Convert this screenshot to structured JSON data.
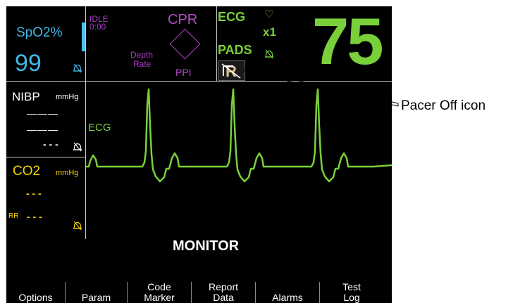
{
  "spo2": {
    "label": "SpO2%",
    "value": "99"
  },
  "cpr": {
    "status": "IDLE",
    "time": "0:00",
    "title": "CPR",
    "depth_label": "Depth",
    "rate_label": "Rate",
    "ppi_label": "PPI"
  },
  "ecg_source": {
    "label": "ECG",
    "gain": "x1",
    "pads_label": "PADS",
    "heart_symbol": "♡",
    "heart_rate": "75"
  },
  "nibp": {
    "label": "NIBP",
    "unit": "mmHg",
    "systolic": "———",
    "diastolic": "———",
    "mean": "- - -"
  },
  "co2": {
    "label": "CO2",
    "unit": "mmHg",
    "value": "- - -",
    "rr_label": "RR",
    "rr_value": "- - -"
  },
  "waveform": {
    "label": "ECG"
  },
  "mode": "MONITOR",
  "softkeys": [
    {
      "label": "Options"
    },
    {
      "label": "Param"
    },
    {
      "label": "Code\nMarker"
    },
    {
      "label": "Report\nData"
    },
    {
      "label": "Alarms"
    },
    {
      "label": "Test\nLog"
    }
  ],
  "callout": {
    "text": "Pacer Off icon"
  },
  "colors": {
    "spo2": "#43b7e6",
    "cpr": "#b54ac8",
    "ecg": "#79d03a",
    "co2": "#f2d400",
    "nibp": "#ffffff"
  }
}
